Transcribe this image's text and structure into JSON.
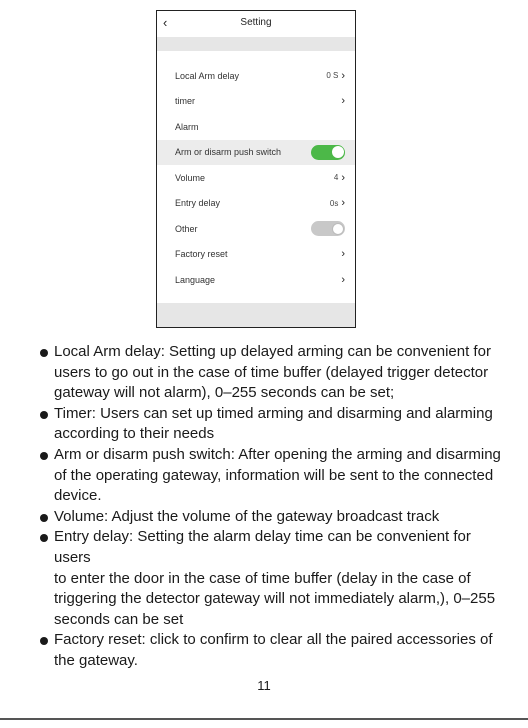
{
  "screen": {
    "back_icon": "chevron-left-icon",
    "title": "Setting",
    "rows": [
      {
        "label": "Local Arm delay",
        "value": "0 S",
        "control": "chevron",
        "shaded": false
      },
      {
        "label": "timer",
        "value": "",
        "control": "chevron",
        "shaded": false
      },
      {
        "label": "Alarm",
        "value": "",
        "control": "none",
        "shaded": false
      },
      {
        "label": "Arm or disarm push switch",
        "value": "",
        "control": "toggle-on",
        "shaded": true
      },
      {
        "label": "Volume",
        "value": "4",
        "control": "chevron",
        "shaded": false
      },
      {
        "label": "Entry delay",
        "value": "0s",
        "control": "chevron",
        "shaded": false
      },
      {
        "label": "Other",
        "value": "",
        "control": "toggle-off",
        "shaded": false
      },
      {
        "label": "Factory reset",
        "value": "",
        "control": "chevron",
        "shaded": false
      },
      {
        "label": "Language",
        "value": "",
        "control": "chevron",
        "shaded": false
      }
    ],
    "toggle_on_color": "#4cb848",
    "toggle_off_color": "#c8c8c8"
  },
  "bullets": [
    [
      "Local Arm delay: Setting up delayed arming can be convenient for",
      "users to go out in the case of time buffer (delayed trigger detector",
      "gateway will not alarm), 0–255 seconds can be set;"
    ],
    [
      "Timer: Users can set up timed arming and disarming and alarming",
      "according to their needs"
    ],
    [
      "Arm or disarm push switch: After opening the arming and disarming",
      "of the operating gateway, information will be sent to the connected",
      "device."
    ],
    [
      "Volume: Adjust the volume of the gateway broadcast track"
    ],
    [
      "Entry delay: Setting the alarm delay time can be convenient for users",
      "to enter the door in the case of time buffer (delay in the case of",
      "triggering the detector gateway will not immediately alarm,), 0–255",
      "seconds can be set"
    ],
    [
      "Factory reset: click to confirm to clear all the paired accessories of",
      "the gateway."
    ]
  ],
  "page_number": "11"
}
